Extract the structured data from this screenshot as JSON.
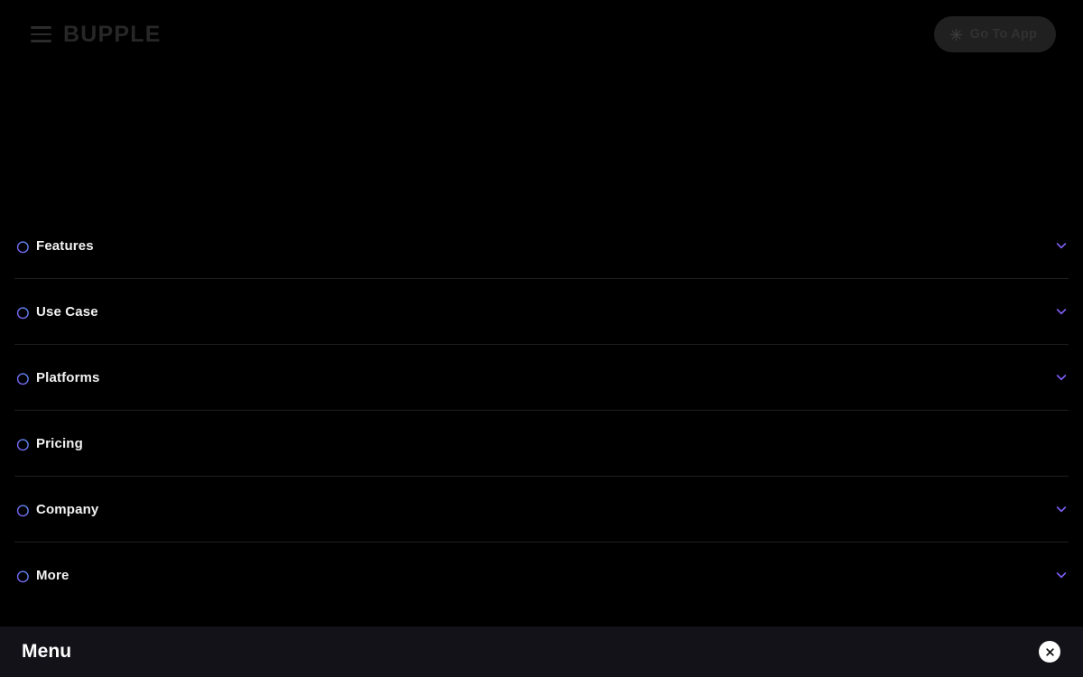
{
  "header": {
    "menu_icon": "hamburger-icon",
    "brand": "BUPPLE",
    "cta": {
      "label": "Go To App",
      "icon": "sparkle-icon"
    }
  },
  "menu": {
    "icon_name": "ring-sparkle-icon",
    "chevron_icon": "chevron-down-icon",
    "items": [
      {
        "label": "Features",
        "expandable": true
      },
      {
        "label": "Use Case",
        "expandable": true
      },
      {
        "label": "Platforms",
        "expandable": true
      },
      {
        "label": "Pricing",
        "expandable": false
      },
      {
        "label": "Company",
        "expandable": true
      },
      {
        "label": "More",
        "expandable": true
      }
    ]
  },
  "bottom_bar": {
    "title": "Menu",
    "close_label": "×",
    "close_icon": "close-icon"
  },
  "colors": {
    "background": "#000000",
    "bottom_bar": "#121218",
    "brand_text": "#272727",
    "cta_bg": "#202020",
    "cta_text": "#313131",
    "label_text": "#f2f2f4",
    "divider": "#1e1e20",
    "accent_purple": "#7c5cf0",
    "accent_blue": "#5b8ff5",
    "close_bg": "#ffffff"
  }
}
